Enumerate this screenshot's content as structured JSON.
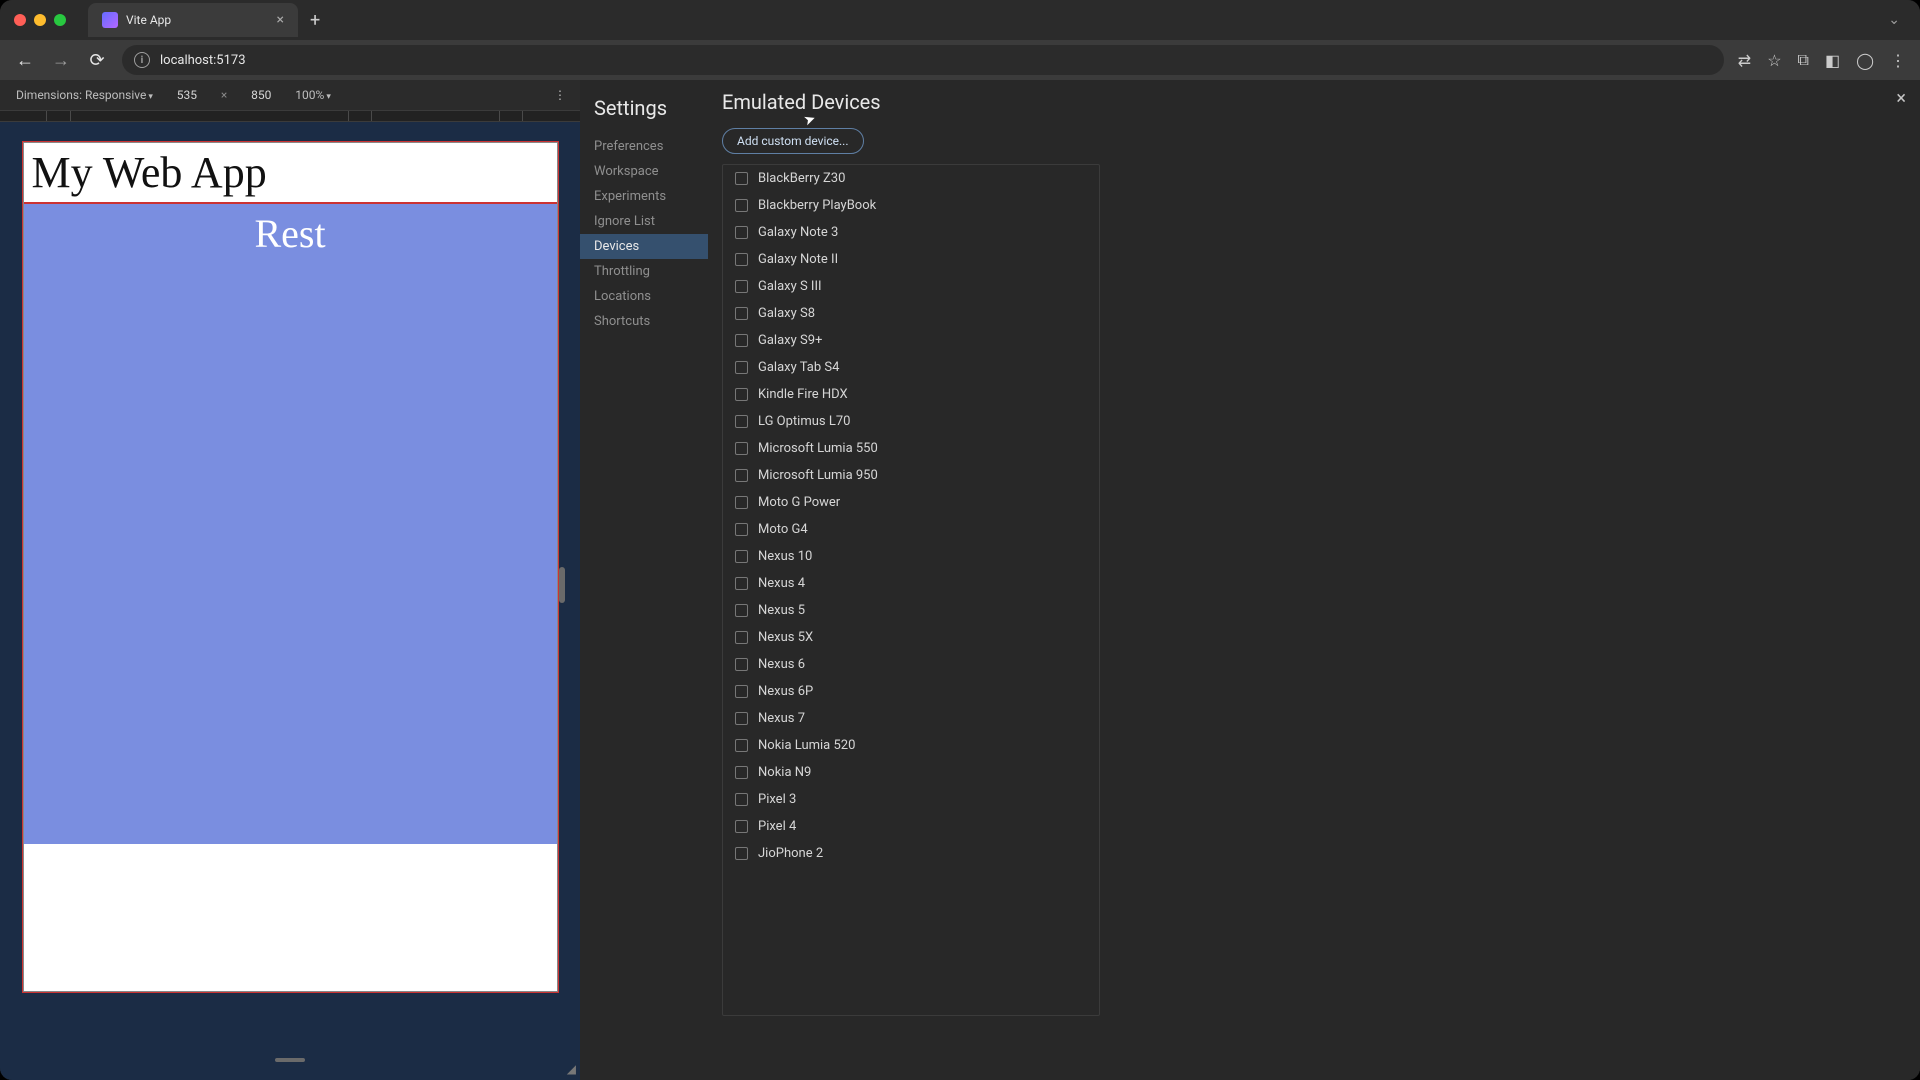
{
  "browser": {
    "tab_title": "Vite App",
    "url": "localhost:5173"
  },
  "device_toolbar": {
    "label": "Dimensions: Responsive",
    "width": "535",
    "height": "850",
    "zoom": "100%"
  },
  "preview": {
    "heading": "My Web App",
    "section": "Rest"
  },
  "settings": {
    "title": "Settings",
    "items": [
      "Preferences",
      "Workspace",
      "Experiments",
      "Ignore List",
      "Devices",
      "Throttling",
      "Locations",
      "Shortcuts"
    ],
    "active_index": 4
  },
  "panel": {
    "title": "Emulated Devices",
    "add_button": "Add custom device...",
    "devices": [
      "BlackBerry Z30",
      "Blackberry PlayBook",
      "Galaxy Note 3",
      "Galaxy Note II",
      "Galaxy S III",
      "Galaxy S8",
      "Galaxy S9+",
      "Galaxy Tab S4",
      "Kindle Fire HDX",
      "LG Optimus L70",
      "Microsoft Lumia 550",
      "Microsoft Lumia 950",
      "Moto G Power",
      "Moto G4",
      "Nexus 10",
      "Nexus 4",
      "Nexus 5",
      "Nexus 5X",
      "Nexus 6",
      "Nexus 6P",
      "Nexus 7",
      "Nokia Lumia 520",
      "Nokia N9",
      "Pixel 3",
      "Pixel 4",
      "JioPhone 2"
    ]
  }
}
